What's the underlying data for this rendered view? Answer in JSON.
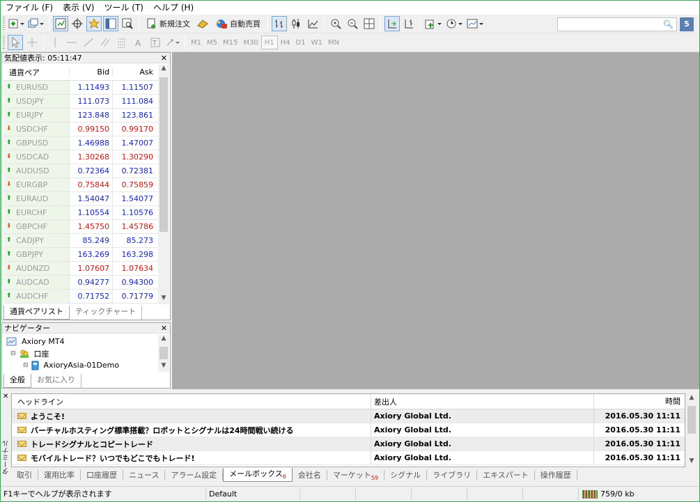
{
  "menu": [
    "ファイル (F)",
    "表示 (V)",
    "ツール (T)",
    "ヘルプ (H)"
  ],
  "toolbar": {
    "new_order": "新規注文",
    "auto_trade": "自動売買",
    "notification_count": "5"
  },
  "timeframes": [
    "M1",
    "M5",
    "M15",
    "M30",
    "H1",
    "H4",
    "D1",
    "W1",
    "MN"
  ],
  "active_timeframe": "H1",
  "market_watch": {
    "title": "気配値表示: 05:11:47",
    "headers": {
      "symbol": "通貨ペア",
      "bid": "Bid",
      "ask": "Ask"
    },
    "rows": [
      {
        "symbol": "EURUSD",
        "bid": "1.11493",
        "ask": "1.11507",
        "dir": "up"
      },
      {
        "symbol": "USDJPY",
        "bid": "111.073",
        "ask": "111.084",
        "dir": "up"
      },
      {
        "symbol": "EURJPY",
        "bid": "123.848",
        "ask": "123.861",
        "dir": "up"
      },
      {
        "symbol": "USDCHF",
        "bid": "0.99150",
        "ask": "0.99170",
        "dir": "down"
      },
      {
        "symbol": "GBPUSD",
        "bid": "1.46988",
        "ask": "1.47007",
        "dir": "up"
      },
      {
        "symbol": "USDCAD",
        "bid": "1.30268",
        "ask": "1.30290",
        "dir": "down"
      },
      {
        "symbol": "AUDUSD",
        "bid": "0.72364",
        "ask": "0.72381",
        "dir": "up"
      },
      {
        "symbol": "EURGBP",
        "bid": "0.75844",
        "ask": "0.75859",
        "dir": "down"
      },
      {
        "symbol": "EURAUD",
        "bid": "1.54047",
        "ask": "1.54077",
        "dir": "up"
      },
      {
        "symbol": "EURCHF",
        "bid": "1.10554",
        "ask": "1.10576",
        "dir": "up"
      },
      {
        "symbol": "GBPCHF",
        "bid": "1.45750",
        "ask": "1.45786",
        "dir": "down"
      },
      {
        "symbol": "CADJPY",
        "bid": "85.249",
        "ask": "85.273",
        "dir": "up"
      },
      {
        "symbol": "GBPJPY",
        "bid": "163.269",
        "ask": "163.298",
        "dir": "up"
      },
      {
        "symbol": "AUDNZD",
        "bid": "1.07607",
        "ask": "1.07634",
        "dir": "down"
      },
      {
        "symbol": "AUDCAD",
        "bid": "0.94277",
        "ask": "0.94300",
        "dir": "up"
      },
      {
        "symbol": "AUDCHF",
        "bid": "0.71752",
        "ask": "0.71779",
        "dir": "up"
      }
    ],
    "tabs": [
      "通貨ペアリスト",
      "ティックチャート"
    ]
  },
  "navigator": {
    "title": "ナビゲーター",
    "root": "Axiory MT4",
    "accounts": "口座",
    "account": "AxioryAsia-01Demo",
    "tabs": [
      "全般",
      "お気に入り"
    ]
  },
  "terminal": {
    "side_label": "ターミナル",
    "headers": {
      "headline": "ヘッドライン",
      "from": "差出人",
      "time": "時間"
    },
    "rows": [
      {
        "headline": "ようこそ!",
        "from": "Axiory Global Ltd.",
        "time": "2016.05.30 11:11"
      },
      {
        "headline": "バーチャルホスティング標準搭載？ロボットとシグナルは24時間戦い続ける",
        "from": "Axiory Global Ltd.",
        "time": "2016.05.30 11:11"
      },
      {
        "headline": "トレードシグナルとコピートレード",
        "from": "Axiory Global Ltd.",
        "time": "2016.05.30 11:11"
      },
      {
        "headline": "モバイルトレード？いつでもどこでもトレード!",
        "from": "Axiory Global Ltd.",
        "time": "2016.05.30 11:11"
      }
    ],
    "tabs": [
      {
        "label": "取引",
        "badge": ""
      },
      {
        "label": "運用比率",
        "badge": ""
      },
      {
        "label": "口座履歴",
        "badge": ""
      },
      {
        "label": "ニュース",
        "badge": ""
      },
      {
        "label": "アラーム設定",
        "badge": ""
      },
      {
        "label": "メールボックス",
        "badge": "6"
      },
      {
        "label": "会社名",
        "badge": ""
      },
      {
        "label": "マーケット",
        "badge": "59"
      },
      {
        "label": "シグナル",
        "badge": ""
      },
      {
        "label": "ライブラリ",
        "badge": ""
      },
      {
        "label": "エキスパート",
        "badge": ""
      },
      {
        "label": "操作履歴",
        "badge": ""
      }
    ],
    "active_tab": 5
  },
  "status": {
    "help": "F1キーでヘルプが表示されます",
    "profile": "Default",
    "traffic": "759/0 kb"
  }
}
